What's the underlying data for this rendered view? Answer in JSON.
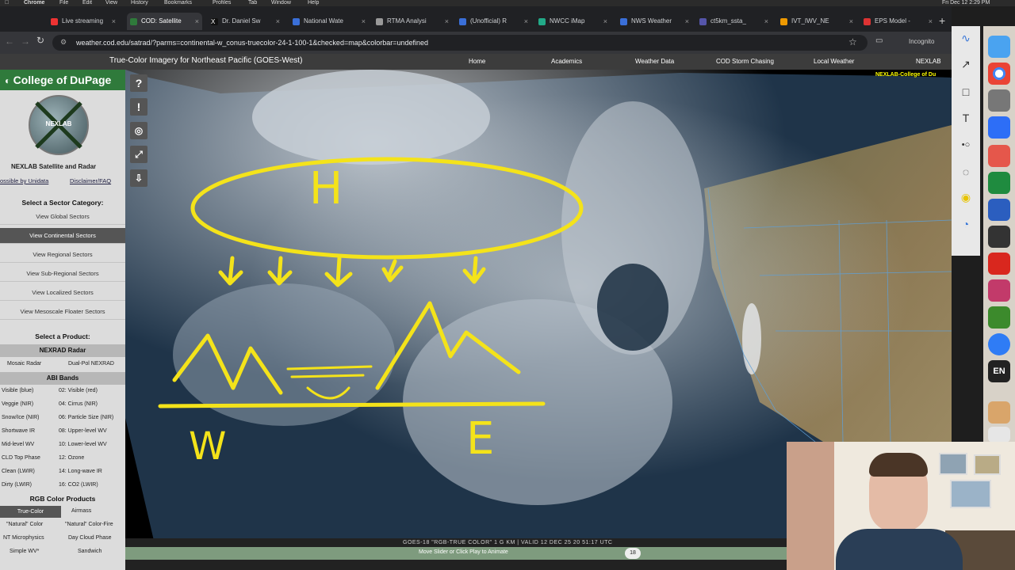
{
  "menubar": {
    "app": "Chrome",
    "items": [
      "File",
      "Edit",
      "View",
      "History",
      "Bookmarks",
      "Profiles",
      "Tab",
      "Window",
      "Help"
    ],
    "clock": "Fri Dec 12  2:29 PM"
  },
  "tabs": [
    {
      "label": "Live streaming",
      "color": "#e33"
    },
    {
      "label": "COD: Satellite",
      "color": "#2f7a3b",
      "active": true
    },
    {
      "label": "Dr. Daniel Sw",
      "color": "#111"
    },
    {
      "label": "National Wate",
      "color": "#3a6fd8"
    },
    {
      "label": "RTMA Analysi",
      "color": "#999"
    },
    {
      "label": "(Unofficial) R",
      "color": "#3a6fd8"
    },
    {
      "label": "NWCC iMap",
      "color": "#2a8"
    },
    {
      "label": "NWS Weather",
      "color": "#3a6fd8"
    },
    {
      "label": "ct5km_ssta_",
      "color": "#55a"
    },
    {
      "label": "IVT_IWV_NE",
      "color": "#e90"
    },
    {
      "label": "EPS Model -",
      "color": "#d33"
    }
  ],
  "address": {
    "url": "weather.cod.edu/satrad/?parms=continental-w_conus-truecolor-24-1-100-1&checked=map&colorbar=undefined",
    "profile": "Incognito"
  },
  "page": {
    "title": "True-Color Imagery for Northeast Pacific (GOES-West)",
    "nav": [
      "Home",
      "Academics",
      "Weather Data",
      "COD Storm Chasing",
      "Local Weather",
      "NEXLAB"
    ]
  },
  "sidebar": {
    "brand": "College of DuPage",
    "logo_text": "NEXLAB",
    "subtitle": "NEXLAB Satellite and Radar",
    "link_left": "ossible by Unidata",
    "link_right": "Disclaimer/FAQ",
    "sector_heading": "Select a Sector Category:",
    "sectors": [
      "View Global Sectors",
      "View Continental Sectors",
      "View Regional Sectors",
      "View Sub-Regional Sectors",
      "View Localized Sectors",
      "View Mesoscale Floater Sectors"
    ],
    "product_heading": "Select a Product:",
    "nexrad_heading": "NEXRAD Radar",
    "nexrad": [
      "Mosaic Radar",
      "Dual-Pol NEXRAD"
    ],
    "abi_heading": "ABI Bands",
    "bands_left": [
      "Visible (blue)",
      "Veggie (NIR)",
      "Snow/Ice (NIR)",
      "Shortwave IR",
      "Mid-level WV",
      "CLD Top Phase",
      "Clean (LWIR)",
      "Dirty (LWIR)"
    ],
    "bands_right": [
      "02: Visible (red)",
      "04: Cirrus (NIR)",
      "06: Particle Size (NIR)",
      "08: Upper-level WV",
      "10: Lower-level WV",
      "12: Ozone",
      "14: Long-wave IR",
      "16: CO2 (LWIR)"
    ],
    "rgb_heading": "RGB Color Products",
    "rgb_left": [
      "True-Color",
      "\"Natural\" Color",
      "NT Microphysics",
      "Simple WV*"
    ],
    "rgb_right": [
      "Airmass",
      "\"Natural\" Color-Fire",
      "Day Cloud Phase",
      "Sandwich"
    ]
  },
  "map": {
    "watermark": "NEXLAB-College of Du",
    "annotations": {
      "high": "H",
      "west": "W",
      "east": "E"
    },
    "tools": [
      "?",
      "!",
      "globe",
      "layers",
      "download"
    ]
  },
  "footer": {
    "caption": "GOES-18 \"RGB-TRUE COLOR\" 1 G KM | VALID 12 DEC 25 20 51:17 UTC",
    "slider_hint": "Move Slider or Click Play to Animate",
    "frame": "18"
  },
  "drawbar": {
    "tools": [
      "pen-icon",
      "arrow-icon",
      "rectangle-icon",
      "text-icon",
      "toggle-icon",
      "rotate-icon",
      "highlighter-icon",
      "timer-icon"
    ]
  },
  "dock": {
    "lang": "EN"
  }
}
